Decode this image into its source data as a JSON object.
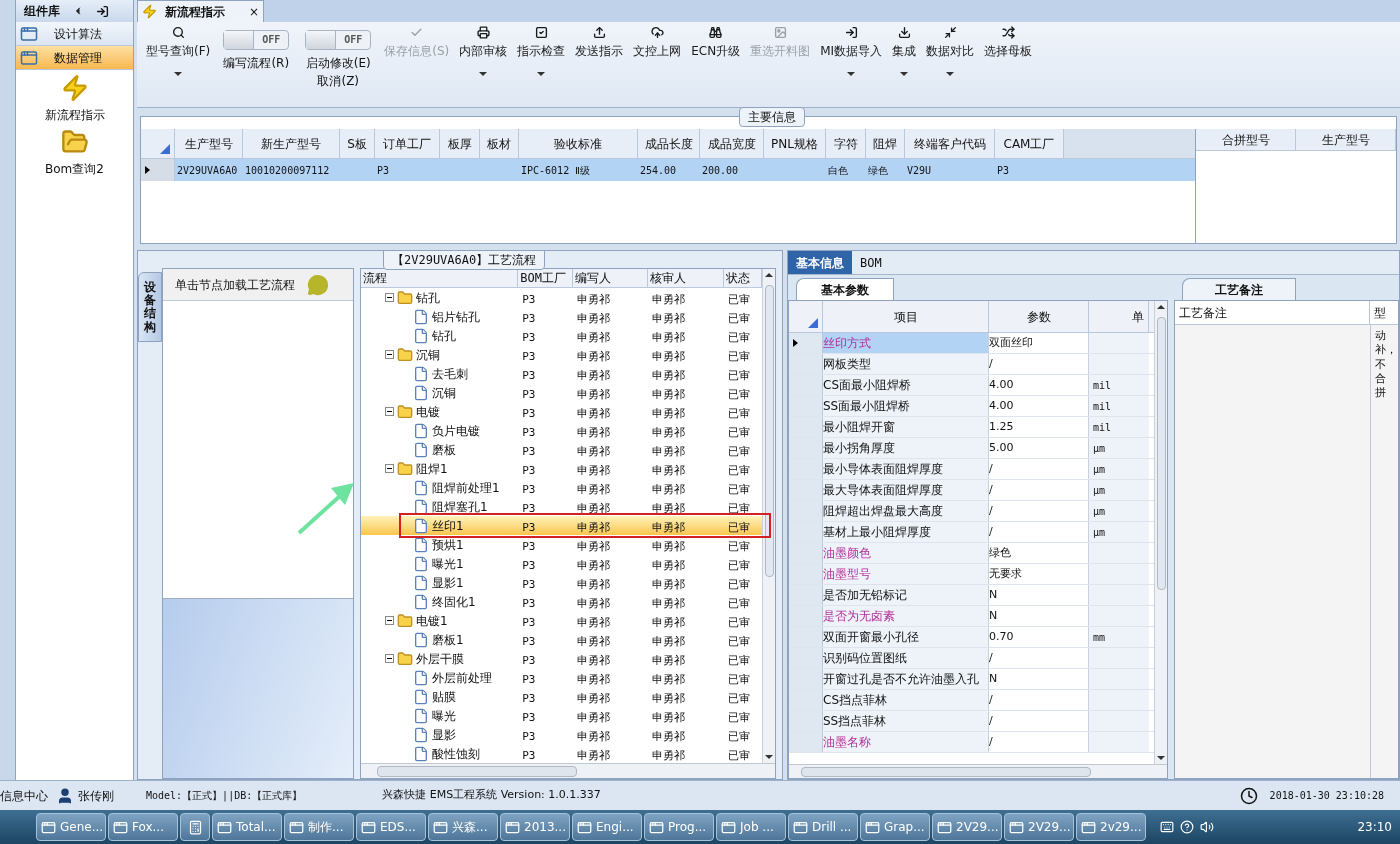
{
  "sidebar": {
    "title": "组件库",
    "items": [
      {
        "label": "设计算法",
        "selected": false
      },
      {
        "label": "数据管理",
        "selected": true
      }
    ],
    "launchers": [
      {
        "label": "新流程指示",
        "kind": "bolt"
      },
      {
        "label": "Bom查询2",
        "kind": "folder"
      }
    ]
  },
  "document_tab": {
    "title": "新流程指示",
    "close": "×"
  },
  "toolbar": [
    {
      "kind": "button",
      "label": "型号查询(F)",
      "dropdown": true,
      "disabled": false
    },
    {
      "kind": "toggle",
      "state": "OFF",
      "on": false,
      "label": "编写流程(R)"
    },
    {
      "kind": "toggle",
      "state": "OFF",
      "on": false,
      "label": "启动修改(E)",
      "label2": "取消(Z)"
    },
    {
      "kind": "button",
      "label": "保存信息(S)",
      "dropdown": false,
      "disabled": true
    },
    {
      "kind": "button",
      "label": "内部审核",
      "dropdown": true,
      "disabled": false
    },
    {
      "kind": "button",
      "label": "指示检查",
      "dropdown": true,
      "disabled": false
    },
    {
      "kind": "button",
      "label": "发送指示",
      "dropdown": false,
      "disabled": false
    },
    {
      "kind": "button",
      "label": "文控上网",
      "dropdown": false,
      "disabled": false
    },
    {
      "kind": "button",
      "label": "ECN升级",
      "dropdown": false,
      "disabled": false
    },
    {
      "kind": "button",
      "label": "重选开料图",
      "dropdown": false,
      "disabled": true
    },
    {
      "kind": "button",
      "label": "MI数据导入",
      "dropdown": true,
      "disabled": false
    },
    {
      "kind": "button",
      "label": "集成",
      "dropdown": true,
      "disabled": false
    },
    {
      "kind": "button",
      "label": "数据对比",
      "dropdown": true,
      "disabled": false
    },
    {
      "kind": "button",
      "label": "选择母板",
      "dropdown": false,
      "disabled": false
    }
  ],
  "main_info": {
    "title": "主要信息",
    "columns": [
      "生产型号",
      "新生产型号",
      "S板",
      "订单工厂",
      "板厚",
      "板材",
      "验收标准",
      "成品长度",
      "成品宽度",
      "PNL规格",
      "字符",
      "阻焊",
      "终端客户代码",
      "CAM工厂"
    ],
    "rows": [
      {
        "selected": true,
        "cells": [
          "2V29UVA6A0",
          "10010200097112",
          null,
          "P3",
          null,
          null,
          "IPC-6012 Ⅱ级",
          "254.00",
          "200.00",
          null,
          "白色",
          "绿色",
          "V29U",
          "P3"
        ]
      }
    ],
    "side_columns": [
      "合拼型号",
      "生产型号"
    ]
  },
  "process": {
    "title": "【2V29UVA6A0】工艺流程",
    "side_tab": "设备结构",
    "hint": "单击节点加载工艺流程",
    "columns": [
      "流程",
      "BOM工厂",
      "编写人",
      "核审人",
      "状态"
    ],
    "tree": [
      {
        "name": "钻孔",
        "factory": "P3",
        "author": "申勇祁",
        "reviewer": "申勇祁",
        "status": "已审",
        "selected": false,
        "expanded": true,
        "children": [
          {
            "name": "铝片钻孔",
            "factory": "P3",
            "author": "申勇祁",
            "reviewer": "申勇祁",
            "status": "已审",
            "selected": false
          },
          {
            "name": "钻孔",
            "factory": "P3",
            "author": "申勇祁",
            "reviewer": "申勇祁",
            "status": "已审",
            "selected": false
          }
        ]
      },
      {
        "name": "沉铜",
        "factory": "P3",
        "author": "申勇祁",
        "reviewer": "申勇祁",
        "status": "已审",
        "selected": false,
        "expanded": true,
        "children": [
          {
            "name": "去毛刺",
            "factory": "P3",
            "author": "申勇祁",
            "reviewer": "申勇祁",
            "status": "已审",
            "selected": false
          },
          {
            "name": "沉铜",
            "factory": "P3",
            "author": "申勇祁",
            "reviewer": "申勇祁",
            "status": "已审",
            "selected": false
          }
        ]
      },
      {
        "name": "电镀",
        "factory": "P3",
        "author": "申勇祁",
        "reviewer": "申勇祁",
        "status": "已审",
        "selected": false,
        "expanded": true,
        "children": [
          {
            "name": "负片电镀",
            "factory": "P3",
            "author": "申勇祁",
            "reviewer": "申勇祁",
            "status": "已审",
            "selected": false
          },
          {
            "name": "磨板",
            "factory": "P3",
            "author": "申勇祁",
            "reviewer": "申勇祁",
            "status": "已审",
            "selected": false
          }
        ]
      },
      {
        "name": "阻焊1",
        "factory": "P3",
        "author": "申勇祁",
        "reviewer": "申勇祁",
        "status": "已审",
        "selected": false,
        "expanded": true,
        "children": [
          {
            "name": "阻焊前处理1",
            "factory": "P3",
            "author": "申勇祁",
            "reviewer": "申勇祁",
            "status": "已审",
            "selected": false
          },
          {
            "name": "阻焊塞孔1",
            "factory": "P3",
            "author": "申勇祁",
            "reviewer": "申勇祁",
            "status": "已审",
            "selected": false
          },
          {
            "name": "丝印1",
            "factory": "P3",
            "author": "申勇祁",
            "reviewer": "申勇祁",
            "status": "已审",
            "selected": true
          },
          {
            "name": "预烘1",
            "factory": "P3",
            "author": "申勇祁",
            "reviewer": "申勇祁",
            "status": "已审",
            "selected": false
          },
          {
            "name": "曝光1",
            "factory": "P3",
            "author": "申勇祁",
            "reviewer": "申勇祁",
            "status": "已审",
            "selected": false
          },
          {
            "name": "显影1",
            "factory": "P3",
            "author": "申勇祁",
            "reviewer": "申勇祁",
            "status": "已审",
            "selected": false
          },
          {
            "name": "终固化1",
            "factory": "P3",
            "author": "申勇祁",
            "reviewer": "申勇祁",
            "status": "已审",
            "selected": false
          }
        ]
      },
      {
        "name": "电镀1",
        "factory": "P3",
        "author": "申勇祁",
        "reviewer": "申勇祁",
        "status": "已审",
        "selected": false,
        "expanded": true,
        "children": [
          {
            "name": "磨板1",
            "factory": "P3",
            "author": "申勇祁",
            "reviewer": "申勇祁",
            "status": "已审",
            "selected": false
          }
        ]
      },
      {
        "name": "外层干膜",
        "factory": "P3",
        "author": "申勇祁",
        "reviewer": "申勇祁",
        "status": "已审",
        "selected": false,
        "expanded": true,
        "children": [
          {
            "name": "外层前处理",
            "factory": "P3",
            "author": "申勇祁",
            "reviewer": "申勇祁",
            "status": "已审",
            "selected": false
          },
          {
            "name": "贴膜",
            "factory": "P3",
            "author": "申勇祁",
            "reviewer": "申勇祁",
            "status": "已审",
            "selected": false
          },
          {
            "name": "曝光",
            "factory": "P3",
            "author": "申勇祁",
            "reviewer": "申勇祁",
            "status": "已审",
            "selected": false
          },
          {
            "name": "显影",
            "factory": "P3",
            "author": "申勇祁",
            "reviewer": "申勇祁",
            "status": "已审",
            "selected": false
          },
          {
            "name": "酸性蚀刻",
            "factory": "P3",
            "author": "申勇祁",
            "reviewer": "申勇祁",
            "status": "已审",
            "selected": false
          }
        ]
      }
    ]
  },
  "detail": {
    "tabs": [
      {
        "label": "基本信息",
        "selected": true
      },
      {
        "label": "BOM",
        "selected": false
      }
    ],
    "params_tab": "基本参数",
    "columns": [
      "项目",
      "参数",
      "单"
    ],
    "params": [
      {
        "item": "丝印方式",
        "value": "双面丝印",
        "emphasized": true,
        "selected": true
      },
      {
        "item": "网板类型",
        "value": "/",
        "emphasized": false,
        "selected": false
      },
      {
        "item": "CS面最小阻焊桥",
        "value": "4.00",
        "unit": "mil",
        "emphasized": false,
        "selected": false
      },
      {
        "item": "SS面最小阻焊桥",
        "value": "4.00",
        "unit": "mil",
        "emphasized": false,
        "selected": false
      },
      {
        "item": "最小阻焊开窗",
        "value": "1.25",
        "unit": "mil",
        "emphasized": false,
        "selected": false
      },
      {
        "item": "最小拐角厚度",
        "value": "5.00",
        "unit": "μm",
        "emphasized": false,
        "selected": false
      },
      {
        "item": "最小导体表面阻焊厚度",
        "value": "/",
        "unit": "μm",
        "emphasized": false,
        "selected": false
      },
      {
        "item": "最大导体表面阻焊厚度",
        "value": "/",
        "unit": "μm",
        "emphasized": false,
        "selected": false
      },
      {
        "item": "阻焊超出焊盘最大高度",
        "value": "/",
        "unit": "μm",
        "emphasized": false,
        "selected": false
      },
      {
        "item": "基材上最小阻焊厚度",
        "value": "/",
        "unit": "μm",
        "emphasized": false,
        "selected": false
      },
      {
        "item": "油墨颜色",
        "value": "绿色",
        "emphasized": true,
        "selected": false
      },
      {
        "item": "油墨型号",
        "value": "无要求",
        "emphasized": true,
        "selected": false
      },
      {
        "item": "是否加无铅标记",
        "value": "N",
        "emphasized": false,
        "selected": false
      },
      {
        "item": "是否为无卤素",
        "value": "N",
        "emphasized": true,
        "selected": false
      },
      {
        "item": "双面开窗最小孔径",
        "value": "0.70",
        "unit": "mm",
        "emphasized": false,
        "selected": false
      },
      {
        "item": "识别码位置图纸",
        "value": "/",
        "emphasized": false,
        "selected": false
      },
      {
        "item": "开窗过孔是否不允许油墨入孔",
        "value": "N",
        "emphasized": false,
        "selected": false
      },
      {
        "item": "CS挡点菲林",
        "value": "/",
        "emphasized": false,
        "selected": false
      },
      {
        "item": "SS挡点菲林",
        "value": "/",
        "emphasized": false,
        "selected": false
      },
      {
        "item": "油墨名称",
        "value": "/",
        "emphasized": true,
        "selected": false
      }
    ],
    "notes_tab": "工艺备注",
    "notes_columns": [
      "工艺备注",
      "型"
    ],
    "notes_text": "动补，不合拼"
  },
  "status_bar": {
    "left": "信息中心",
    "user": "张传刚",
    "model": "Model:【正式】||DB:【正式库】",
    "system": "兴森快捷 EMS工程系统 Version: 1.0.1.337",
    "datetime": "2018-01-30 23:10:28"
  },
  "taskbar": {
    "items": [
      {
        "kind": "labeled",
        "label": "Gene..."
      },
      {
        "kind": "labeled",
        "label": "Fox..."
      },
      {
        "kind": "icon"
      },
      {
        "kind": "labeled",
        "label": "Total..."
      },
      {
        "kind": "labeled",
        "label": "制作..."
      },
      {
        "kind": "labeled",
        "label": "EDS..."
      },
      {
        "kind": "labeled",
        "label": "兴森..."
      },
      {
        "kind": "labeled",
        "label": "2013..."
      },
      {
        "kind": "labeled",
        "label": "Engi..."
      },
      {
        "kind": "labeled",
        "label": "Prog..."
      },
      {
        "kind": "labeled",
        "label": "Job ..."
      },
      {
        "kind": "labeled",
        "label": "Drill ..."
      },
      {
        "kind": "labeled",
        "label": "Grap..."
      },
      {
        "kind": "labeled",
        "label": "2V29..."
      },
      {
        "kind": "labeled",
        "label": "2V29..."
      },
      {
        "kind": "labeled",
        "label": "2v29..."
      }
    ],
    "clock": "23:10"
  }
}
